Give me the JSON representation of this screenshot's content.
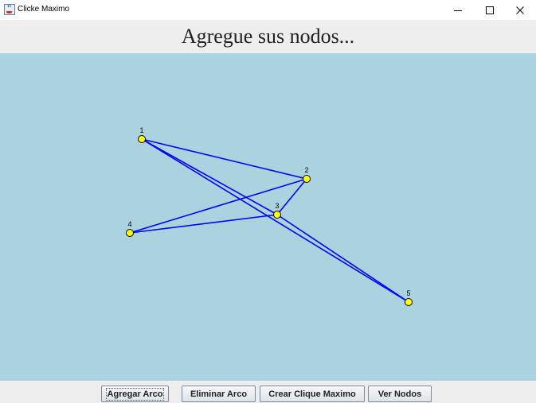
{
  "window": {
    "title": "Clicke Maximo",
    "minimize_glyph": "–",
    "maximize_glyph": "☐",
    "close_glyph": "✕",
    "app_icon": "java-cup-icon"
  },
  "header": {
    "title": "Agregue sus nodos..."
  },
  "graph": {
    "node_color": "#ffff00",
    "edge_color": "#0000ff",
    "background": "#aad3df",
    "nodes": [
      {
        "id": "1",
        "label": "1"
      },
      {
        "id": "2",
        "label": "2"
      },
      {
        "id": "3",
        "label": "3"
      },
      {
        "id": "4",
        "label": "4"
      },
      {
        "id": "5",
        "label": "5"
      }
    ],
    "edges": [
      [
        "1",
        "2"
      ],
      [
        "1",
        "3"
      ],
      [
        "1",
        "5"
      ],
      [
        "2",
        "3"
      ],
      [
        "2",
        "4"
      ],
      [
        "3",
        "4"
      ],
      [
        "3",
        "5"
      ]
    ]
  },
  "toolbar": {
    "add_edge": "Agregar Arco",
    "delete_edge": "Eliminar Arco",
    "max_clique": "Crear Clique Maximo",
    "view_nodes": "Ver Nodos"
  }
}
